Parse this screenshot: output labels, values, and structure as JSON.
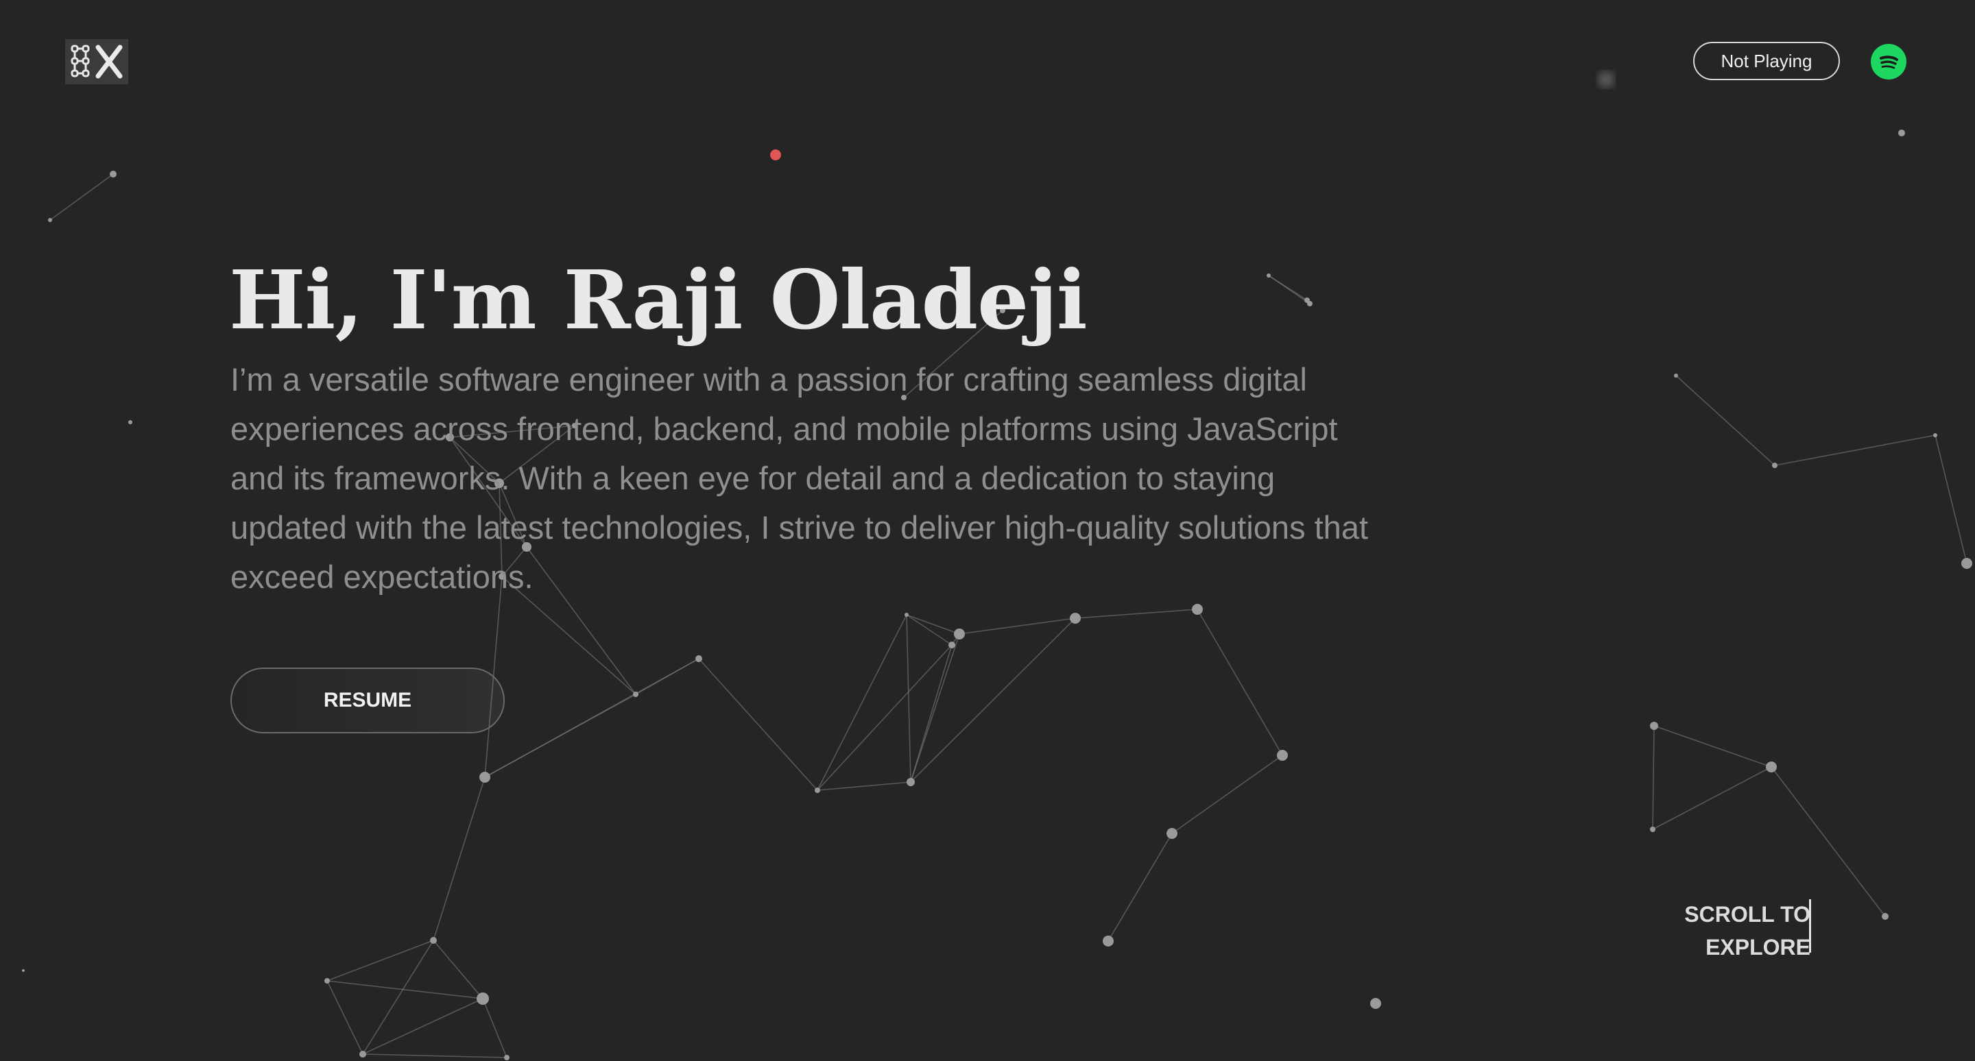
{
  "header": {
    "logo_icon": "kx-monogram-logo",
    "now_playing_label": "Not Playing",
    "spotify_icon": "spotify-icon"
  },
  "hero": {
    "title": "Hi, I'm Raji Oladeji",
    "description": "I’m a versatile software engineer with a passion for crafting seamless digital experiences across frontend, backend, and mobile platforms using JavaScript and its frameworks. With a keen eye for detail and a dedication to staying updated with the latest technologies, I strive to deliver high-quality solutions that exceed expectations.",
    "resume_label": "RESUME"
  },
  "scroll_hint": {
    "line1": "SCROLL TO",
    "line2": "EXPLORE"
  },
  "colors": {
    "background": "#252525",
    "accent_dot": "#e05555",
    "spotify_green": "#1ed760",
    "particle": "#9a9a9a"
  }
}
